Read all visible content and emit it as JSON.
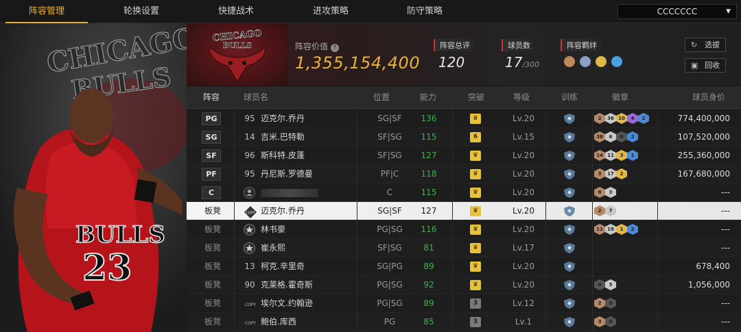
{
  "nav": {
    "tabs": [
      "阵容管理",
      "轮换设置",
      "快捷战术",
      "进攻策略",
      "防守策略"
    ],
    "active_tab": 0,
    "user": "CCCCCCC"
  },
  "header": {
    "team_logo_text": "CHICAGO BULLS",
    "lineup_value_label": "阵容价值",
    "lineup_value": "1,355,154,400",
    "overall_label": "阵容总评",
    "overall_value": "120",
    "players_label": "球员数",
    "players_value": "17",
    "players_max": "/300",
    "bond_label": "阵容羁绊",
    "pick_button": "选拔",
    "recycle_button": "回收"
  },
  "table": {
    "headers": [
      "阵容",
      "球员名",
      "位置",
      "能力",
      "突破",
      "等级",
      "训练",
      "徽章",
      "球员身价"
    ],
    "rows": [
      {
        "slot": "PG",
        "num": "95",
        "name": "迈克尔.乔丹",
        "pos": "SG|SF",
        "ability": "136",
        "breakthrough": "crown",
        "level": "Lv.20",
        "badges": [
          [
            "2",
            "#b58a6a"
          ],
          [
            "36",
            "#c8c8c8"
          ],
          [
            "10",
            "#e0b84a"
          ],
          [
            "4",
            "#9a6ad8"
          ],
          [
            "2",
            "#4a8ad8"
          ]
        ],
        "price": "774,400,000"
      },
      {
        "slot": "SG",
        "num": "14",
        "name": "吉米.巴特勒",
        "pos": "SF|SG",
        "ability": "115",
        "breakthrough": "6",
        "level": "Lv.15",
        "badges": [
          [
            "38",
            "#b58a6a"
          ],
          [
            "6",
            "#c8c8c8"
          ],
          [
            "0",
            "#555555"
          ],
          [
            "2",
            "#4a8ad8"
          ]
        ],
        "price": "107,520,000"
      },
      {
        "slot": "SF",
        "num": "96",
        "name": "斯科特.皮蓬",
        "pos": "SF|SG",
        "ability": "127",
        "breakthrough": "crown",
        "level": "Lv.20",
        "badges": [
          [
            "14",
            "#b58a6a"
          ],
          [
            "11",
            "#c8c8c8"
          ],
          [
            "3",
            "#e0b84a"
          ],
          [
            "1",
            "#4a8ad8"
          ]
        ],
        "price": "255,360,000"
      },
      {
        "slot": "PF",
        "num": "95",
        "name": "丹尼斯.罗德曼",
        "pos": "PF|C",
        "ability": "118",
        "breakthrough": "crown",
        "level": "Lv.20",
        "badges": [
          [
            "3",
            "#b58a6a"
          ],
          [
            "17",
            "#c8c8c8"
          ],
          [
            "2",
            "#e0b84a"
          ]
        ],
        "price": "167,680,000"
      },
      {
        "slot": "C",
        "num": "",
        "name": "",
        "pos": "C",
        "ability": "115",
        "breakthrough": "crown",
        "level": "Lv.20",
        "badges": [
          [
            "8",
            "#b58a6a"
          ],
          [
            "3",
            "#c8c8c8"
          ]
        ],
        "price": "---"
      },
      {
        "slot": "板凳",
        "num": "COPY",
        "name": "迈克尔.乔丹",
        "pos": "SG|SF",
        "ability": "127",
        "breakthrough": "crown",
        "level": "Lv.20",
        "badges": [
          [
            "2",
            "#b58a6a"
          ],
          [
            "7",
            "#c8c8c8"
          ]
        ],
        "price": "---",
        "selected": true
      },
      {
        "slot": "板凳",
        "num": "star",
        "name": "林书豪",
        "pos": "PG|SG",
        "ability": "116",
        "breakthrough": "crown",
        "level": "Lv.20",
        "badges": [
          [
            "11",
            "#b58a6a"
          ],
          [
            "19",
            "#c8c8c8"
          ],
          [
            "1",
            "#e0b84a"
          ],
          [
            "2",
            "#4a8ad8"
          ]
        ],
        "price": "---"
      },
      {
        "slot": "板凳",
        "num": "star",
        "name": "崔永熙",
        "pos": "SF|SG",
        "ability": "81",
        "breakthrough": "crown",
        "level": "Lv.17",
        "badges": [],
        "price": "---"
      },
      {
        "slot": "板凳",
        "num": "13",
        "name": "柯克.辛里奇",
        "pos": "SG|PG",
        "ability": "89",
        "breakthrough": "crown",
        "level": "Lv.20",
        "badges": [],
        "price": "678,400"
      },
      {
        "slot": "板凳",
        "num": "90",
        "name": "克莱格.霍奇斯",
        "pos": "PG|SG",
        "ability": "92",
        "breakthrough": "crown",
        "level": "Lv.20",
        "badges": [
          [
            "0",
            "#555555"
          ],
          [
            "5",
            "#c8c8c8"
          ]
        ],
        "price": "1,056,000"
      },
      {
        "slot": "板凳",
        "num": "COPY",
        "name": "埃尔文.约翰逊",
        "pos": "PG|SG",
        "ability": "89",
        "breakthrough": "3",
        "level": "Lv.12",
        "badges": [
          [
            "2",
            "#b58a6a"
          ],
          [
            "0",
            "#555555"
          ]
        ],
        "price": "---"
      },
      {
        "slot": "板凳",
        "num": "COPY",
        "name": "鲍伯.库西",
        "pos": "PG",
        "ability": "85",
        "breakthrough": "3",
        "level": "Lv.1",
        "badges": [
          [
            "3",
            "#b58a6a"
          ],
          [
            "0",
            "#555555"
          ]
        ],
        "price": "---"
      }
    ]
  },
  "colors": {
    "accent": "#e8b23a",
    "ability_green": "#3fb24a",
    "red_tag": "#d0343a"
  }
}
